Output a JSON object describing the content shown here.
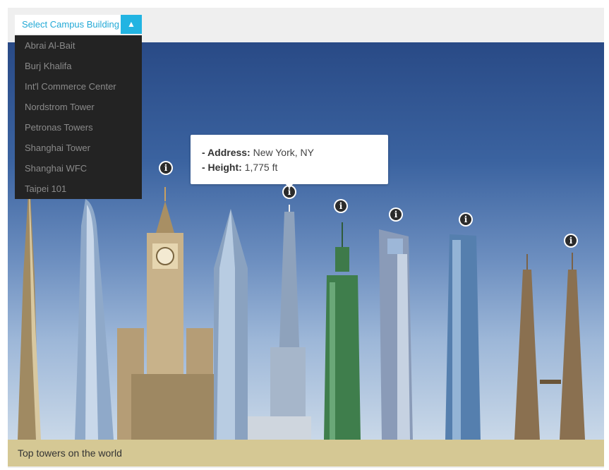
{
  "selector": {
    "label": "Select Campus Building",
    "toggle_glyph": "▲",
    "options": [
      "Abrai Al-Bait",
      "Burj Khalifa",
      "Int'l Commerce Center",
      "Nordstrom Tower",
      "Petronas Towers",
      "Shanghai Tower",
      "Shanghai WFC",
      "Taipei 101"
    ]
  },
  "tooltip": {
    "address_label": "- Address:",
    "address_value": "New York, NY",
    "height_label": "- Height:",
    "height_value": "1,775 ft"
  },
  "info_marker_glyph": "i",
  "caption": "Top towers on the world",
  "colors": {
    "accent": "#22b4e2",
    "menu_bg": "#232323",
    "caption_bg": "#d5c894",
    "sky_top": "#294a86"
  }
}
